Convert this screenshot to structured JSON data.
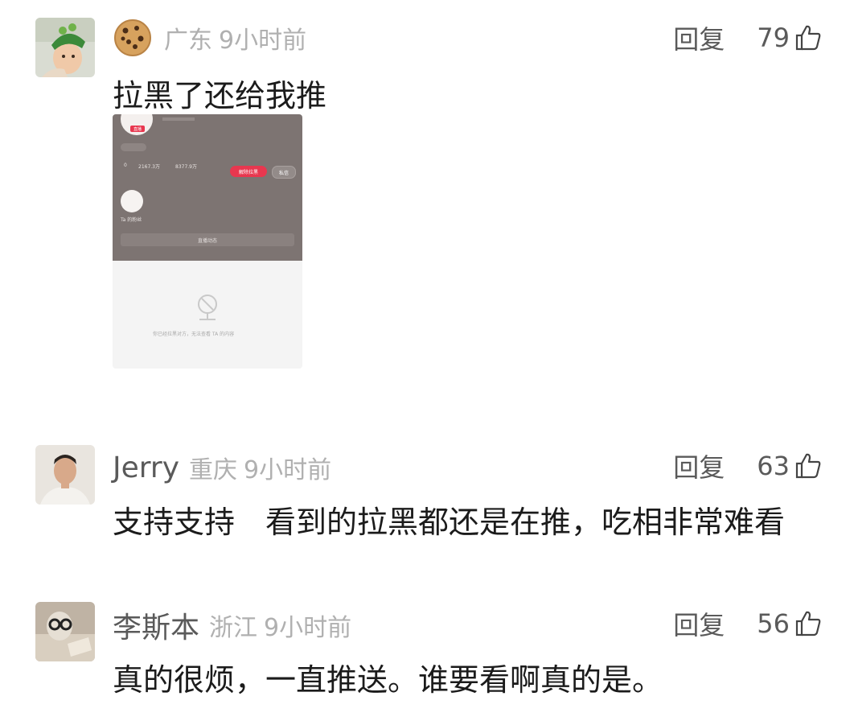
{
  "comments": [
    {
      "location": "广东",
      "time": "9小时前",
      "reply_label": "回复",
      "likes": "79",
      "text": "拉黑了还给我推",
      "nick_icon": "cookie-icon",
      "screenshot": {
        "badge": "直播",
        "stat_1": "0",
        "stat_2": "2167.3万",
        "stat_3": "8377.9万",
        "unblock_label": "解除拉黑",
        "message_label": "私信",
        "follower_label": "Ta 的粉丝",
        "live_bar": "直播动态",
        "blocked_notice": "你已经拉黑对方，无法查看 TA 的内容"
      }
    },
    {
      "nickname": "Jerry",
      "location": "重庆",
      "time": "9小时前",
      "reply_label": "回复",
      "likes": "63",
      "text": "支持支持　看到的拉黑都还是在推，吃相非常难看"
    },
    {
      "nickname": "李斯本",
      "location": "浙江",
      "time": "9小时前",
      "reply_label": "回复",
      "likes": "56",
      "text": "真的很烦，一直推送。谁要看啊真的是。"
    }
  ],
  "colors": {
    "nickname": "#5a5a5a",
    "meta": "#b0b0b0",
    "body": "#1b1b1b",
    "unblock_button": "#e8374f"
  }
}
